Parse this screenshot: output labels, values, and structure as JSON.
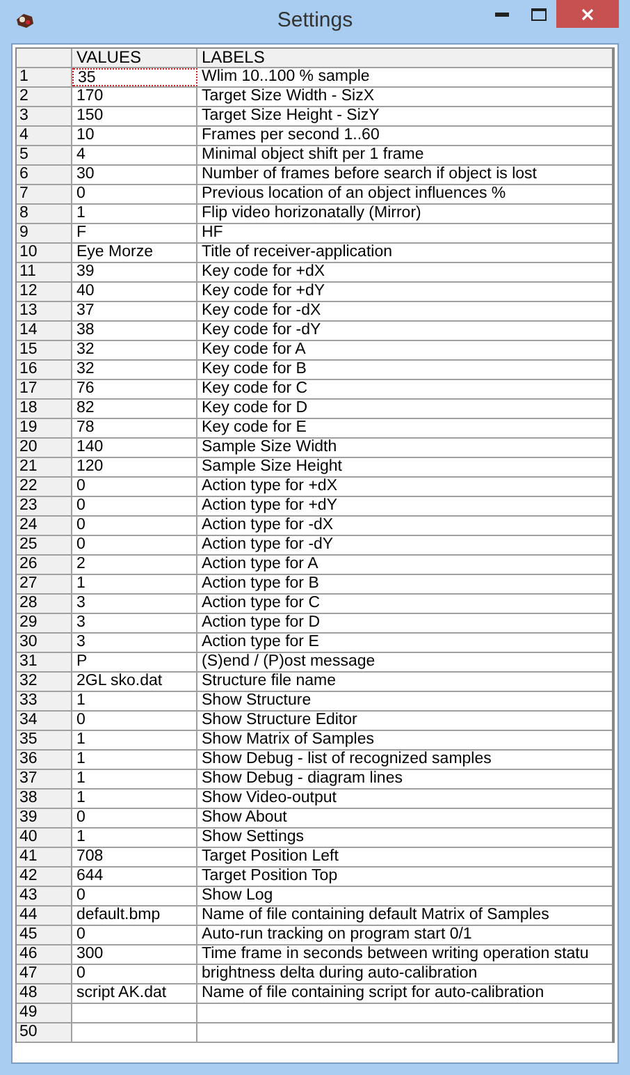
{
  "window": {
    "title": "Settings"
  },
  "table": {
    "columns": [
      "VALUES",
      "LABELS"
    ],
    "rows": [
      {
        "number": "1",
        "value": "35",
        "label": "Wlim 10..100 % sample",
        "focused": true
      },
      {
        "number": "2",
        "value": "170",
        "label": "Target Size Width - SizX",
        "focused": false
      },
      {
        "number": "3",
        "value": "150",
        "label": "Target Size Height - SizY",
        "focused": false
      },
      {
        "number": "4",
        "value": "10",
        "label": "Frames per second 1..60",
        "focused": false
      },
      {
        "number": "5",
        "value": "4",
        "label": "Minimal object shift per 1 frame",
        "focused": false
      },
      {
        "number": "6",
        "value": "30",
        "label": "Number of frames before search if object is lost",
        "focused": false
      },
      {
        "number": "7",
        "value": "0",
        "label": "Previous location of an object influences %",
        "focused": false
      },
      {
        "number": "8",
        "value": "1",
        "label": "Flip video horizonatally (Mirror)",
        "focused": false
      },
      {
        "number": "9",
        "value": "F",
        "label": "HF",
        "focused": false
      },
      {
        "number": "10",
        "value": "Eye Morze",
        "label": "Title of receiver-application",
        "focused": false
      },
      {
        "number": "11",
        "value": "39",
        "label": "Key code for +dX",
        "focused": false
      },
      {
        "number": "12",
        "value": "40",
        "label": "Key code for +dY",
        "focused": false
      },
      {
        "number": "13",
        "value": "37",
        "label": "Key code for -dX",
        "focused": false
      },
      {
        "number": "14",
        "value": "38",
        "label": "Key code for -dY",
        "focused": false
      },
      {
        "number": "15",
        "value": "32",
        "label": "Key code for A",
        "focused": false
      },
      {
        "number": "16",
        "value": "32",
        "label": "Key code for B",
        "focused": false
      },
      {
        "number": "17",
        "value": "76",
        "label": "Key code for C",
        "focused": false
      },
      {
        "number": "18",
        "value": "82",
        "label": "Key code for D",
        "focused": false
      },
      {
        "number": "19",
        "value": "78",
        "label": "Key code for E",
        "focused": false
      },
      {
        "number": "20",
        "value": "140",
        "label": "Sample Size Width",
        "focused": false
      },
      {
        "number": "21",
        "value": "120",
        "label": "Sample Size Height",
        "focused": false
      },
      {
        "number": "22",
        "value": "0",
        "label": "Action type for +dX",
        "focused": false
      },
      {
        "number": "23",
        "value": "0",
        "label": "Action type for +dY",
        "focused": false
      },
      {
        "number": "24",
        "value": "0",
        "label": "Action type for -dX",
        "focused": false
      },
      {
        "number": "25",
        "value": "0",
        "label": "Action type for -dY",
        "focused": false
      },
      {
        "number": "26",
        "value": "2",
        "label": "Action type for A",
        "focused": false
      },
      {
        "number": "27",
        "value": "1",
        "label": "Action type for B",
        "focused": false
      },
      {
        "number": "28",
        "value": "3",
        "label": "Action type for C",
        "focused": false
      },
      {
        "number": "29",
        "value": "3",
        "label": "Action type for D",
        "focused": false
      },
      {
        "number": "30",
        "value": "3",
        "label": "Action type for E",
        "focused": false
      },
      {
        "number": "31",
        "value": "P",
        "label": "(S)end / (P)ost message",
        "focused": false
      },
      {
        "number": "32",
        "value": "2GL sko.dat",
        "label": "Structure file name",
        "focused": false
      },
      {
        "number": "33",
        "value": "1",
        "label": "Show Structure",
        "focused": false
      },
      {
        "number": "34",
        "value": "0",
        "label": "Show Structure Editor",
        "focused": false
      },
      {
        "number": "35",
        "value": "1",
        "label": "Show Matrix of Samples",
        "focused": false
      },
      {
        "number": "36",
        "value": "1",
        "label": "Show Debug - list of recognized samples",
        "focused": false
      },
      {
        "number": "37",
        "value": "1",
        "label": "Show Debug - diagram lines",
        "focused": false
      },
      {
        "number": "38",
        "value": "1",
        "label": "Show Video-output",
        "focused": false
      },
      {
        "number": "39",
        "value": "0",
        "label": "Show About",
        "focused": false
      },
      {
        "number": "40",
        "value": "1",
        "label": "Show Settings",
        "focused": false
      },
      {
        "number": "41",
        "value": "708",
        "label": "Target Position Left",
        "focused": false
      },
      {
        "number": "42",
        "value": "644",
        "label": "Target Position Top",
        "focused": false
      },
      {
        "number": "43",
        "value": "0",
        "label": "Show Log",
        "focused": false
      },
      {
        "number": "44",
        "value": "default.bmp",
        "label": "Name of file containing default Matrix of Samples",
        "focused": false
      },
      {
        "number": "45",
        "value": "0",
        "label": "Auto-run tracking on program start 0/1",
        "focused": false
      },
      {
        "number": "46",
        "value": "300",
        "label": "Time frame in seconds between writing operation statu",
        "focused": false
      },
      {
        "number": "47",
        "value": "0",
        "label": "brightness delta during auto-calibration",
        "focused": false
      },
      {
        "number": "48",
        "value": "script AK.dat",
        "label": "Name of file containing script for auto-calibration",
        "focused": false
      },
      {
        "number": "49",
        "focused": false
      },
      {
        "number": "50",
        "focused": false
      }
    ]
  }
}
